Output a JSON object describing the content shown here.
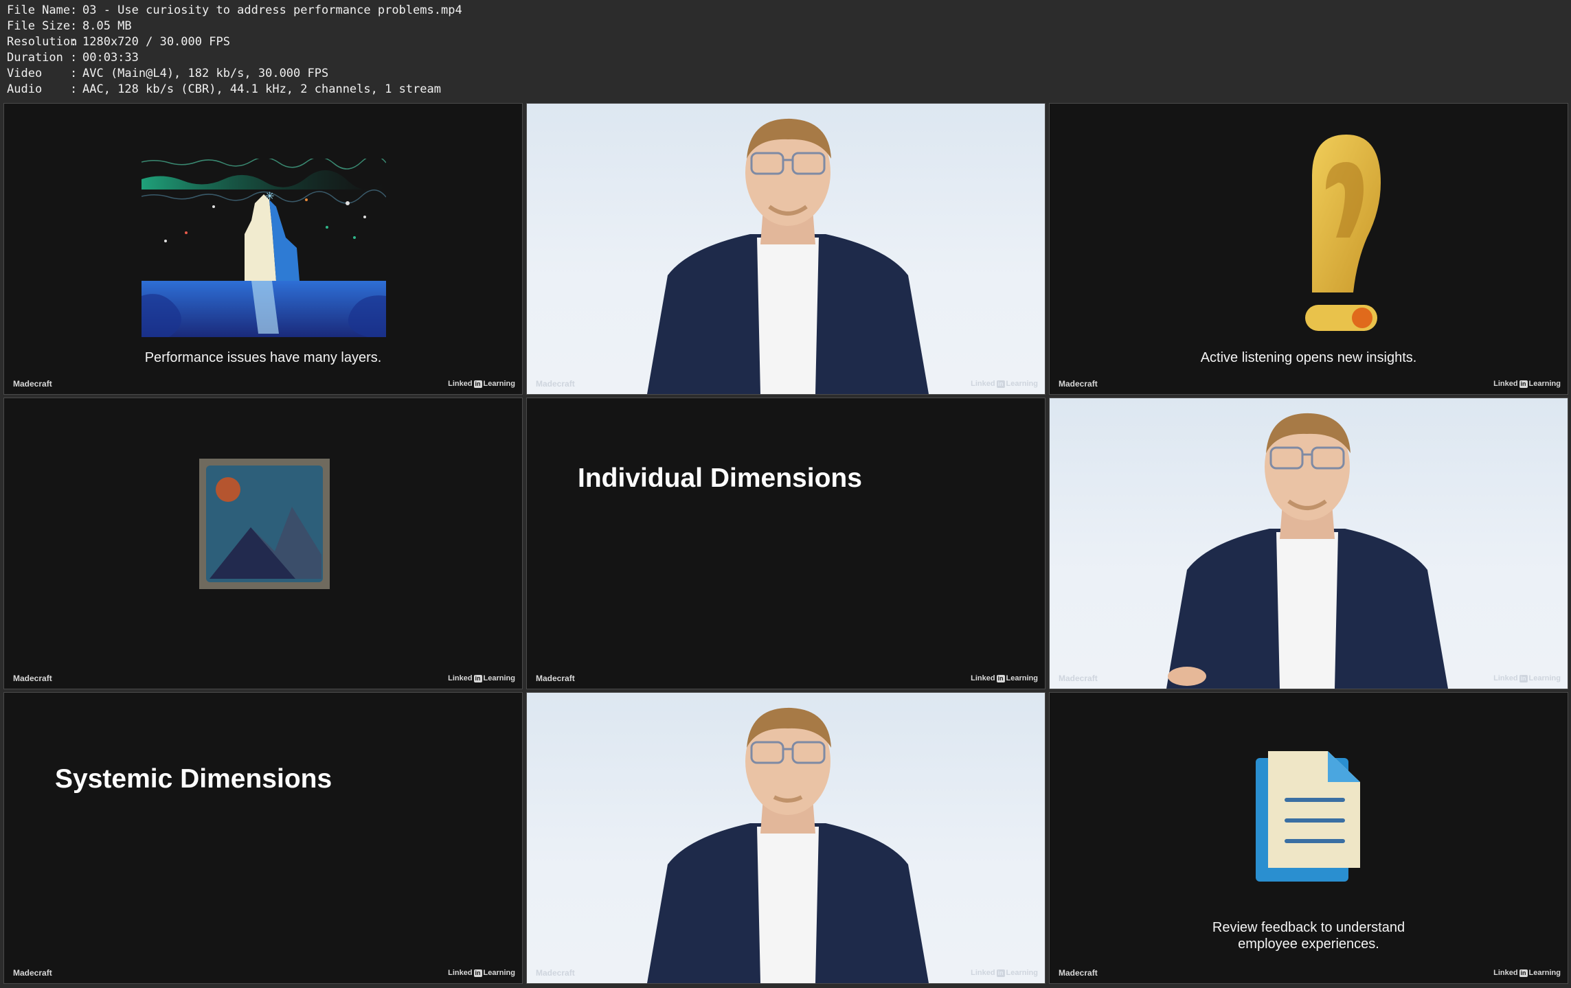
{
  "file_info": [
    {
      "key": "File Name",
      "value": "03 - Use curiosity to address performance problems.mp4"
    },
    {
      "key": "File Size",
      "value": "8.05 MB"
    },
    {
      "key": "Resolution",
      "value": "1280x720 / 30.000 FPS"
    },
    {
      "key": "Duration",
      "value": "00:03:33"
    },
    {
      "key": "Video",
      "value": "AVC (Main@L4), 182 kb/s, 30.000 FPS"
    },
    {
      "key": "Audio",
      "value": "AAC, 128 kb/s (CBR), 44.1 kHz, 2 channels, 1 stream"
    }
  ],
  "separator": ":",
  "watermark": {
    "left": "Madecraft",
    "right_pre": "Linked",
    "right_in": "in",
    "right_post": "Learning"
  },
  "frames": {
    "f1_caption": "Performance issues have many layers.",
    "f3_caption": "Active listening opens new insights.",
    "f5_title": "Individual Dimensions",
    "f7_title": "Systemic Dimensions",
    "f9_caption_line1": "Review feedback to understand",
    "f9_caption_line2": "employee experiences."
  },
  "colors": {
    "dark_bg": "#141414",
    "light_bg": "#e6edf5",
    "ear_gold": "#e9c24b",
    "ear_accent": "#e06a1c",
    "doc_blue": "#2a8fd0",
    "doc_paper": "#efe6c6"
  },
  "icons": [
    "iceberg-illustration",
    "ear-exclamation-icon",
    "image-placeholder-icon",
    "document-icon"
  ]
}
